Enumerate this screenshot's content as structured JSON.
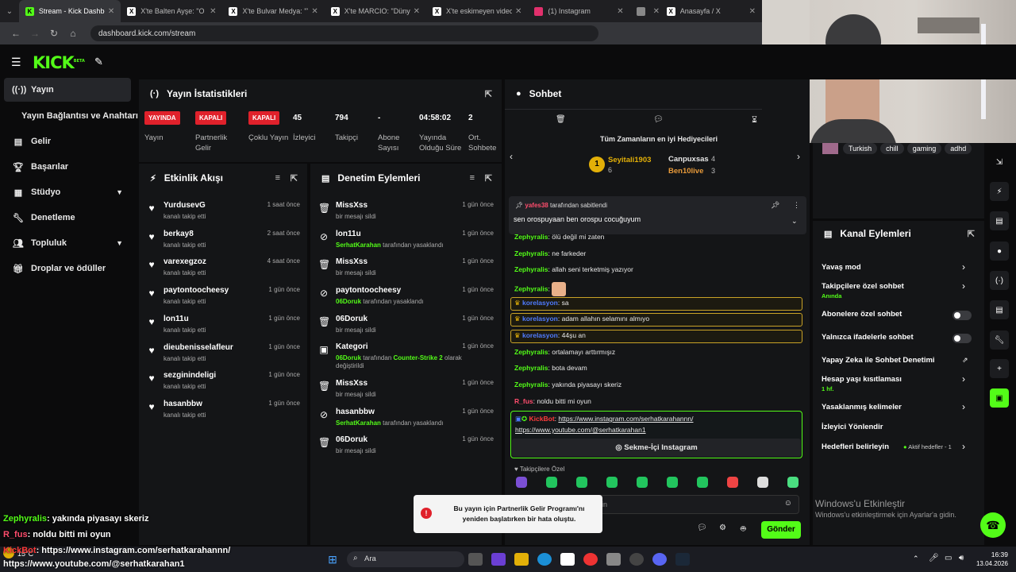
{
  "browser": {
    "tabs": [
      {
        "label": "Stream - Kick Dashboard",
        "active": true
      },
      {
        "label": "X'te Balten Ayşe: \"O çaresi",
        "active": false
      },
      {
        "label": "X'te Bulvar Medya: \"Yaşlı",
        "active": false
      },
      {
        "label": "X'te MARCIO: \"Dünya futl",
        "active": false
      },
      {
        "label": "X'te eskimeyen videolar: \"",
        "active": false
      },
      {
        "label": "(1) Instagram",
        "active": false
      },
      {
        "label": "",
        "active": false
      },
      {
        "label": "Anasayfa / X",
        "active": false
      }
    ],
    "url": "dashboard.kick.com/stream"
  },
  "brand": {
    "logo": "KICK",
    "beta": "BETA",
    "accent": "#53fc18"
  },
  "nav": {
    "items": [
      {
        "label": "Yayın",
        "icon": "broadcast-icon"
      },
      {
        "label": "Yayın Bağlantısı ve Anahtarı",
        "icon": ""
      },
      {
        "label": "Gelir",
        "icon": "chart-icon"
      },
      {
        "label": "Başarılar",
        "icon": "trophy-icon"
      },
      {
        "label": "Stüdyo",
        "icon": "grid-icon"
      },
      {
        "label": "Denetleme",
        "icon": "wrench-icon"
      },
      {
        "label": "Topluluk",
        "icon": "people-icon"
      },
      {
        "label": "Droplar ve ödüller",
        "icon": "gift-icon"
      }
    ]
  },
  "stats": {
    "title": "Yayın İstatistikleri",
    "items": [
      {
        "badge": "YAYINDA",
        "label": "Yayın"
      },
      {
        "badge": "KAPALI",
        "label": "Partnerlik Gelir Programı"
      },
      {
        "badge": "KAPALI",
        "label": "Çoklu Yayın"
      },
      {
        "value": "45",
        "label": "İzleyici"
      },
      {
        "value": "794",
        "label": "Takipçi"
      },
      {
        "value": "-",
        "label": "Abone Sayısı"
      },
      {
        "value": "04:58:02",
        "label": "Yayında Olduğu Süre"
      },
      {
        "value": "2",
        "label": "Ort. Sohbete Katılanlar"
      }
    ]
  },
  "activity": {
    "title": "Etkinlik Akışı",
    "rows": [
      {
        "name": "YurdusevG",
        "sub": "kanalı takip etti",
        "time": "1 saat önce"
      },
      {
        "name": "berkay8",
        "sub": "kanalı takip etti",
        "time": "2 saat önce"
      },
      {
        "name": "varexegzoz",
        "sub": "kanalı takip etti",
        "time": "4 saat önce"
      },
      {
        "name": "paytontoocheesy",
        "sub": "kanalı takip etti",
        "time": "1 gün önce"
      },
      {
        "name": "lon11u",
        "sub": "kanalı takip etti",
        "time": "1 gün önce"
      },
      {
        "name": "dieubenisselafleur",
        "sub": "kanalı takip etti",
        "time": "1 gün önce"
      },
      {
        "name": "sezginindeligi",
        "sub": "kanalı takip etti",
        "time": "1 gün önce"
      },
      {
        "name": "hasanbbw",
        "sub": "kanalı takip etti",
        "time": "1 gün önce"
      }
    ]
  },
  "moderation": {
    "title": "Denetim Eylemleri",
    "rows": [
      {
        "icon": "trash-icon",
        "name": "MissXss",
        "sub_actor": "",
        "sub": "bir mesajı sildi",
        "time": "1 gün önce"
      },
      {
        "icon": "ban-icon",
        "name": "lon11u",
        "sub_actor": "SerhatKarahan",
        "sub": "tarafından yasaklandı",
        "time": "1 gün önce"
      },
      {
        "icon": "trash-icon",
        "name": "MissXss",
        "sub_actor": "",
        "sub": "bir mesajı sildi",
        "time": "1 gün önce"
      },
      {
        "icon": "ban-icon",
        "name": "paytontoocheesy",
        "sub_actor": "06Doruk",
        "sub": "tarafından yasaklandı",
        "time": "1 gün önce"
      },
      {
        "icon": "trash-icon",
        "name": "06Doruk",
        "sub_actor": "",
        "sub": "bir mesajı sildi",
        "time": "1 gün önce"
      },
      {
        "icon": "category-icon",
        "name": "Kategori",
        "sub_actor": "06Doruk",
        "sub": "tarafından",
        "sub_game": "Counter-Strike 2",
        "sub_tail": "olarak değiştirildi",
        "time": "1 gün önce"
      },
      {
        "icon": "trash-icon",
        "name": "MissXss",
        "sub_actor": "",
        "sub": "bir mesajı sildi",
        "time": "1 gün önce"
      },
      {
        "icon": "ban-icon",
        "name": "hasanbbw",
        "sub_actor": "SerhatKarahan",
        "sub": "tarafından yasaklandı",
        "time": "1 gün önce"
      },
      {
        "icon": "trash-icon",
        "name": "06Doruk",
        "sub_actor": "",
        "sub": "bir mesajı sildi",
        "time": "1 gün önce"
      }
    ]
  },
  "chat": {
    "title": "Sohbet",
    "gifters_title": "Tüm Zamanların en iyi Hediyecileri",
    "gifters": [
      {
        "rank": "1",
        "name": "Seyitali1903",
        "count": "6"
      },
      {
        "name": "Canpuxsas",
        "count": "4"
      },
      {
        "name": "Ben10live",
        "count": "3"
      }
    ],
    "pinned": {
      "by_user": "yafes38",
      "by_text": "tarafından sabitlendi",
      "text": "sen orospuyaan ben orospu cocuğuyum"
    },
    "messages": [
      {
        "user": "Zephyralis",
        "color": "#53fc18",
        "text": "ölü değil mi zaten",
        "highlight": false
      },
      {
        "user": "Zephyralis",
        "color": "#53fc18",
        "text": "ne farkeder",
        "highlight": false
      },
      {
        "user": "Zephyralis",
        "color": "#53fc18",
        "text": "allah seni terketmiş yazıyor",
        "highlight": false
      },
      {
        "user": "Zephyralis",
        "color": "#53fc18",
        "text": "",
        "emote": true,
        "highlight": false
      },
      {
        "user": "korelasyon",
        "color": "#4f7bff",
        "text": "sa",
        "highlight": true
      },
      {
        "user": "korelasyon",
        "color": "#4f7bff",
        "text": "adam allahın selamını almıyo",
        "highlight": true
      },
      {
        "user": "korelasyon",
        "color": "#4f7bff",
        "text": "44şu an",
        "highlight": true
      },
      {
        "user": "Zephyralis",
        "color": "#53fc18",
        "text": "ortalamayı arttırmışız",
        "highlight": false
      },
      {
        "user": "Zephyralis",
        "color": "#53fc18",
        "text": "bota devam",
        "highlight": false
      },
      {
        "user": "Zephyralis",
        "color": "#53fc18",
        "text": "yakında piyasayı skeriz",
        "highlight": false
      },
      {
        "user": "R_fus",
        "color": "#ff4d6d",
        "text": "noldu bitti mi oyun",
        "highlight": false
      }
    ],
    "bot": {
      "user": "KickBot",
      "link1": "https://www.instagram.com/serhatkarahannn/",
      "link2": "https://www.youtube.com/@serhatkarahan1",
      "button": "Sekme-İçi Instagram"
    },
    "followers_only": "Takipçilere Özel",
    "input_placeholder": "in",
    "send": "Gönder"
  },
  "channel_actions": {
    "tags": [
      "Turkish",
      "chill",
      "gaming",
      "adhd"
    ],
    "title": "Kanal Eylemleri",
    "items": [
      {
        "label": "Yavaş mod",
        "sub": ""
      },
      {
        "label": "Takipçilere özel sohbet",
        "sub": "Anında"
      },
      {
        "label": "Abonelere özel sohbet",
        "sub": ""
      },
      {
        "label": "Yalnızca ifadelerle sohbet",
        "sub": ""
      },
      {
        "label": "Yapay Zeka ile Sohbet Denetimi",
        "sub": ""
      },
      {
        "label": "Hesap yaşı kısıtlaması",
        "sub": "1 hf."
      },
      {
        "label": "Yasaklanmış kelimeler",
        "sub": ""
      },
      {
        "label": "İzleyici Yönlendir",
        "sub": ""
      },
      {
        "label": "Hedefleri belirleyin",
        "sub": "",
        "status": "Aktif hedefler - 1"
      }
    ]
  },
  "toast": "Bu yayın için Partnerlik Gelir Programı'nı yeniden başlatırken bir hata oluştu.",
  "watermark": {
    "line1": "Windows'u Etkinleştir",
    "line2": "Windows'u etkinleştirmek için Ayarlar'a gidin."
  },
  "overlay": [
    {
      "user": "Zephyralis",
      "color": "#53fc18",
      "text": ": yakında piyasayı skeriz"
    },
    {
      "user": "R_fus",
      "color": "#ff4d6d",
      "text": ": noldu bitti mi oyun"
    },
    {
      "user": "KickBot",
      "color": "#ff3b3b",
      "text": ": https://www.instagram.com/serhatkarahannn/"
    },
    {
      "user": "",
      "color": "#ffffff",
      "text": "https://www.youtube.com/@serhatkarahan1"
    }
  ],
  "taskbar": {
    "weather": "15°C",
    "search": "Ara",
    "time": "16:39",
    "date": "13.04.2026"
  }
}
